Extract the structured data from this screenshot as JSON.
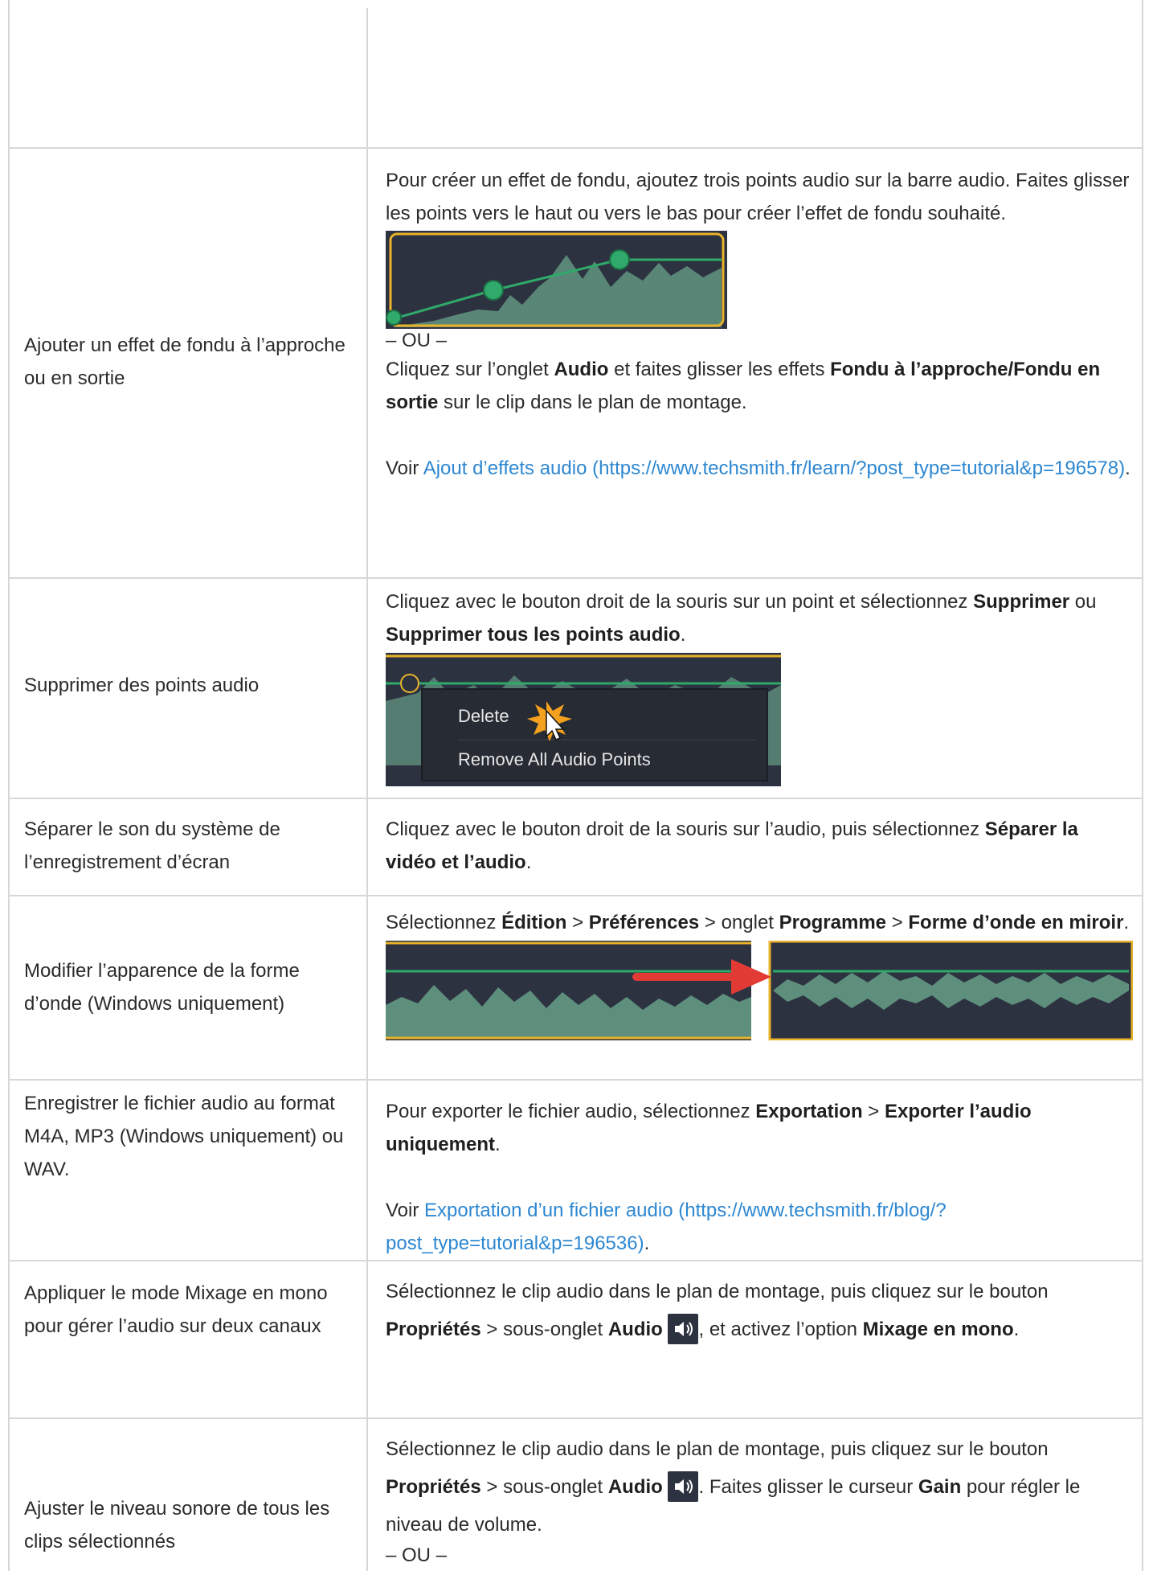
{
  "rows": [
    {
      "left": ""
    },
    {
      "left": "Ajouter un effet de fondu à l’approche ou en sortie",
      "p1": "Pour créer un effet de fondu, ajoutez trois points audio sur la barre audio. Faites glisser les points vers le haut ou vers le bas pour créer l’effet de fondu souhaité.",
      "ou": "– OU –",
      "p2_a": "Cliquez sur l’onglet ",
      "p2_b": "Audio",
      "p2_c": " et faites glisser les effets ",
      "p2_d": "Fondu à l’approche/Fondu en sortie",
      "p2_e": " sur le clip dans le plan de montage.",
      "voir": "Voir ",
      "link": "Ajout d’effets audio (https://www.techsmith.fr/learn/?post_type=tutorial&p=196578)",
      "end": "."
    },
    {
      "left": "Supprimer des points audio",
      "p_a": "Cliquez avec le bouton droit de la souris sur un point et sélectionnez ",
      "p_b": "Supprimer",
      "p_c": " ou ",
      "p_d": "Supprimer tous les points audio",
      "p_e": ".",
      "menu_delete": "Delete",
      "menu_remove": "Remove All Audio Points"
    },
    {
      "left": "Séparer le son du système de l’enregistrement d’écran",
      "p_a": "Cliquez avec le bouton droit de la souris sur l’audio, puis sélectionnez ",
      "p_b": "Séparer la vidéo et l’audio",
      "p_c": "."
    },
    {
      "left": "Modifier l’apparence de la forme d’onde (Windows uniquement)",
      "p_a": "Sélectionnez ",
      "p_b": "Édition",
      "p_c": " > ",
      "p_d": "Préférences",
      "p_e": " > onglet ",
      "p_f": "Programme",
      "p_g": " > ",
      "p_h": "Forme d’onde en miroir",
      "p_i": "."
    },
    {
      "left": "Enregistrer le fichier audio au format M4A, MP3 (Windows uniquement) ou WAV.",
      "p_a": "Pour exporter le fichier audio, sélectionnez ",
      "p_b": "Exportation",
      "p_c": " > ",
      "p_d": "Exporter l’audio uniquement",
      "p_e": ".",
      "voir": "Voir ",
      "link": "Exportation d’un fichier audio (https://www.techsmith.fr/blog/?post_type=tutorial&p=196536)",
      "end": "."
    },
    {
      "left": "Appliquer le mode Mixage en mono pour gérer l’audio sur deux canaux",
      "p_a": "Sélectionnez le clip audio dans le plan de montage, puis cliquez sur le bouton ",
      "p_b": "Propriétés",
      "p_c": " > sous-onglet ",
      "p_d": "Audio",
      "p_e": ", et activez l’option ",
      "p_f": "Mixage en mono",
      "p_g": "."
    },
    {
      "left": "Ajuster le niveau sonore de tous les clips sélectionnés",
      "p_a": "Sélectionnez le clip audio dans le plan de montage, puis cliquez sur le bouton ",
      "p_b": "Propriétés",
      "p_c": " > sous-onglet ",
      "p_d": "Audio",
      "p_e": ". Faites glisser le curseur ",
      "p_f": "Gain",
      "p_g": " pour régler le niveau de volume.",
      "ou": "– OU –"
    }
  ],
  "colors": {
    "border": "#d7d7d7",
    "link": "#2d87d1",
    "waveform_bg": "#2d3240",
    "waveform_fill": "#5e8f7d",
    "track_line": "#2faa6a",
    "clip_border": "#e8b22a",
    "arrow": "#e23b36"
  }
}
